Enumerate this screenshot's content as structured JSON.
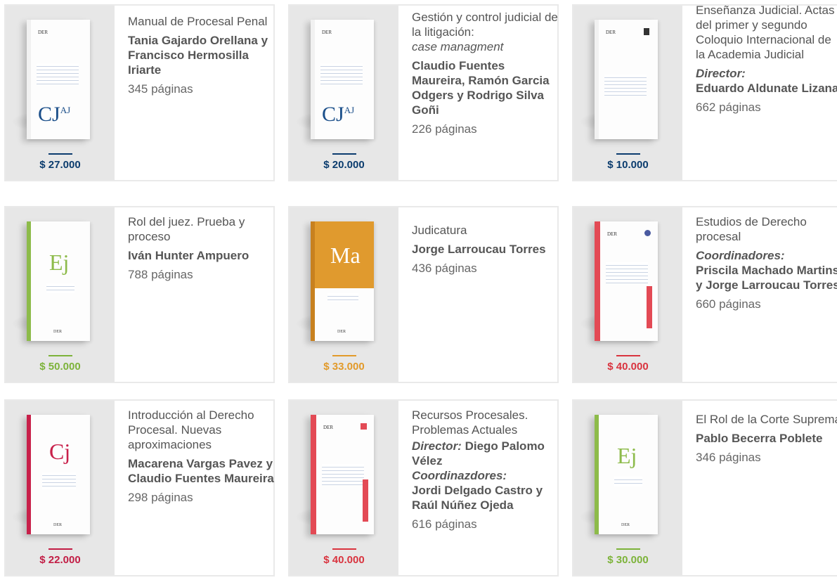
{
  "books": [
    {
      "title": "Manual de Procesal Penal",
      "subtitle": "",
      "authors_label": "",
      "authors": "Tania Gajardo Orellana y Francisco Hermosilla Iriarte",
      "coord_label": "",
      "coordinators": "",
      "pages": "345 páginas",
      "price": "$ 27.000",
      "price_color": "#0b3c6e",
      "cover_logo": "CJ",
      "cover_logo_sup": "AJ",
      "cover_accent": "#1b4f8a",
      "publisher_mark": "DER"
    },
    {
      "title": "Gestión y control judicial de la litigación:",
      "subtitle": "case managment",
      "authors_label": "",
      "authors": "Claudio Fuentes Maureira, Ramón Garcia Odgers y Rodrigo Silva Goñi",
      "coord_label": "",
      "coordinators": "",
      "pages": "226 páginas",
      "price": "$ 20.000",
      "price_color": "#0b3c6e",
      "cover_logo": "CJ",
      "cover_logo_sup": "AJ",
      "cover_accent": "#1b4f8a",
      "publisher_mark": "DER"
    },
    {
      "title": "Enseñanza Judicial. Actas del primer y segundo Coloquio Internacional de la Academia Judicial",
      "subtitle": "",
      "authors_label": "Director:",
      "authors": "Eduardo Aldunate Lizana",
      "coord_label": "",
      "coordinators": "",
      "pages": "662 páginas",
      "price": "$ 10.000",
      "price_color": "#0b3c6e",
      "cover_logo": "",
      "cover_logo_sup": "",
      "cover_accent": "#1b4f8a",
      "publisher_mark": "DER"
    },
    {
      "title": "Rol del juez. Prueba y proceso",
      "subtitle": "",
      "authors_label": "",
      "authors": "Iván Hunter Ampuero",
      "coord_label": "",
      "coordinators": "",
      "pages": "788 páginas",
      "price": "$ 50.000",
      "price_color": "#7db33a",
      "cover_logo": "Ej",
      "cover_logo_sup": "",
      "cover_accent": "#8dbb4a",
      "publisher_mark": "DER"
    },
    {
      "title": "Judicatura",
      "subtitle": "",
      "authors_label": "",
      "authors": "Jorge Larroucau Torres",
      "coord_label": "",
      "coordinators": "",
      "pages": "436 páginas",
      "price": "$ 33.000",
      "price_color": "#e29a2a",
      "cover_logo": "Ma",
      "cover_logo_sup": "",
      "cover_accent": "#e09a2e",
      "publisher_mark": "DER"
    },
    {
      "title": "Estudios de Derecho procesal",
      "subtitle": "",
      "authors_label": "Coordinadores:",
      "authors": "Priscila Machado Martins y Jorge Larroucau Torres",
      "coord_label": "",
      "coordinators": "",
      "pages": "660 páginas",
      "price": "$ 40.000",
      "price_color": "#d9343f",
      "cover_logo": "",
      "cover_logo_sup": "",
      "cover_accent": "#e34a55",
      "publisher_mark": "DER"
    },
    {
      "title": "Introducción al Derecho Procesal. Nuevas aproximaciones",
      "subtitle": "",
      "authors_label": "",
      "authors": "Macarena Vargas Pavez y Claudio Fuentes Maureira",
      "coord_label": "",
      "coordinators": "",
      "pages": "298 páginas",
      "price": "$ 22.000",
      "price_color": "#c21d45",
      "cover_logo": "Cj",
      "cover_logo_sup": "",
      "cover_accent": "#c8204a",
      "publisher_mark": "DER"
    },
    {
      "title": "Recursos Procesales. Problemas Actuales",
      "subtitle": "",
      "authors_label": "Director:",
      "authors": "Diego Palomo Vélez",
      "coord_label": "Coordinazdores:",
      "coordinators": "Jordi Delgado Castro y Raúl Núñez Ojeda",
      "pages": "616 páginas",
      "price": "$ 40.000",
      "price_color": "#d9343f",
      "cover_logo": "",
      "cover_logo_sup": "",
      "cover_accent": "#e34a55",
      "publisher_mark": "DER"
    },
    {
      "title": "El Rol de la Corte Suprema",
      "subtitle": "",
      "authors_label": "",
      "authors": "Pablo Becerra Poblete",
      "coord_label": "",
      "coordinators": "",
      "pages": "346 páginas",
      "price": "$ 30.000",
      "price_color": "#7db33a",
      "cover_logo": "Ej",
      "cover_logo_sup": "",
      "cover_accent": "#8dbb4a",
      "publisher_mark": "DER"
    }
  ]
}
